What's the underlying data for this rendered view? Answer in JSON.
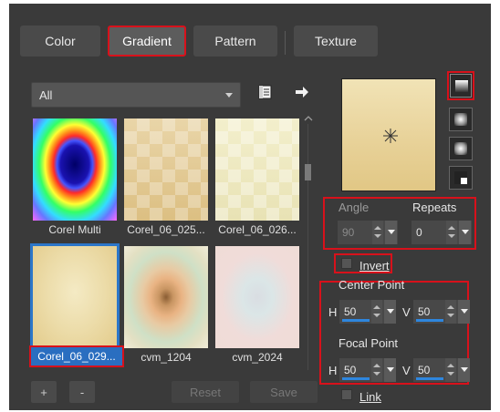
{
  "tabs": [
    {
      "label": "Color"
    },
    {
      "label": "Gradient"
    },
    {
      "label": "Pattern"
    },
    {
      "label": "Texture"
    }
  ],
  "category": {
    "selected": "All"
  },
  "thumbnails": [
    {
      "caption": "Corel Multi"
    },
    {
      "caption": "Corel_06_025..."
    },
    {
      "caption": "Corel_06_026..."
    },
    {
      "caption": "Corel_06_029..."
    },
    {
      "caption": "cvm_1204"
    },
    {
      "caption": "cvm_2024"
    }
  ],
  "buttons": {
    "add": "+",
    "remove": "-",
    "reset": "Reset",
    "save": "Save"
  },
  "angle": {
    "label": "Angle",
    "value": "90"
  },
  "repeats": {
    "label": "Repeats",
    "value": "0"
  },
  "invert": {
    "label": "Invert",
    "checked": false
  },
  "center_point": {
    "label": "Center Point",
    "h_label": "H",
    "h_value": "50",
    "v_label": "V",
    "v_value": "50"
  },
  "focal_point": {
    "label": "Focal Point",
    "h_label": "H",
    "h_value": "50",
    "v_label": "V",
    "v_value": "50"
  },
  "link": {
    "label": "Link",
    "checked": false
  },
  "colors": {
    "accent": "#d8111b",
    "selection": "#2a6ec0",
    "slider": "#2e86de"
  }
}
